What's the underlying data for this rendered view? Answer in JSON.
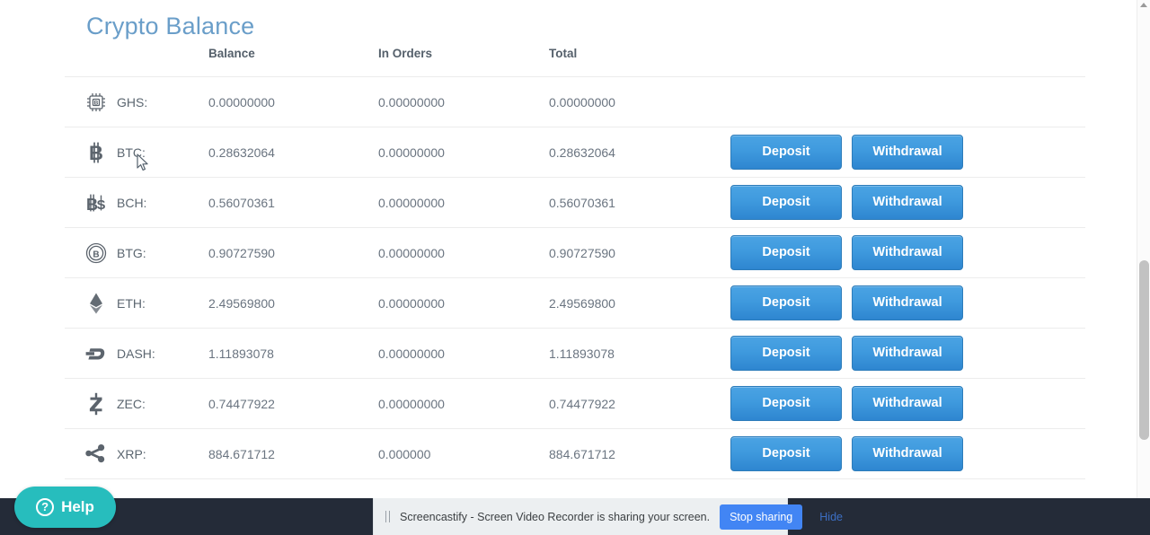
{
  "page": {
    "title": "Crypto Balance"
  },
  "table": {
    "headers": {
      "icon": "",
      "name": "",
      "balance": "Balance",
      "in_orders": "In Orders",
      "total": "Total",
      "actions": ""
    },
    "rows": [
      {
        "icon": "ghs-chip-icon",
        "ticker": "GHS:",
        "balance": "0.00000000",
        "in_orders": "0.00000000",
        "total": "0.00000000",
        "has_actions": false
      },
      {
        "icon": "btc-icon",
        "ticker": "BTC:",
        "balance": "0.28632064",
        "in_orders": "0.00000000",
        "total": "0.28632064",
        "has_actions": true
      },
      {
        "icon": "bch-icon",
        "ticker": "BCH:",
        "balance": "0.56070361",
        "in_orders": "0.00000000",
        "total": "0.56070361",
        "has_actions": true
      },
      {
        "icon": "btg-icon",
        "ticker": "BTG:",
        "balance": "0.90727590",
        "in_orders": "0.00000000",
        "total": "0.90727590",
        "has_actions": true
      },
      {
        "icon": "eth-icon",
        "ticker": "ETH:",
        "balance": "2.49569800",
        "in_orders": "0.00000000",
        "total": "2.49569800",
        "has_actions": true
      },
      {
        "icon": "dash-icon",
        "ticker": "DASH:",
        "balance": "1.11893078",
        "in_orders": "0.00000000",
        "total": "1.11893078",
        "has_actions": true
      },
      {
        "icon": "zec-icon",
        "ticker": "ZEC:",
        "balance": "0.74477922",
        "in_orders": "0.00000000",
        "total": "0.74477922",
        "has_actions": true
      },
      {
        "icon": "xrp-icon",
        "ticker": "XRP:",
        "balance": "884.671712",
        "in_orders": "0.000000",
        "total": "884.671712",
        "has_actions": true
      }
    ],
    "actions": {
      "deposit_label": "Deposit",
      "withdrawal_label": "Withdrawal"
    }
  },
  "help_widget": {
    "icon": "question-circle-icon",
    "glyph": "?",
    "label": "Help"
  },
  "share_notification": {
    "grip_icon": "drag-grip-icon",
    "message": "Screencastify - Screen Video Recorder is sharing your screen.",
    "stop_label": "Stop sharing",
    "hide_label": "Hide"
  },
  "colors": {
    "title": "#6a9ec9",
    "button_blue": "#3f9ade",
    "help_teal": "#27bdbd",
    "stop_sharing_blue": "#4285f4",
    "bottom_bar": "#242b38"
  }
}
